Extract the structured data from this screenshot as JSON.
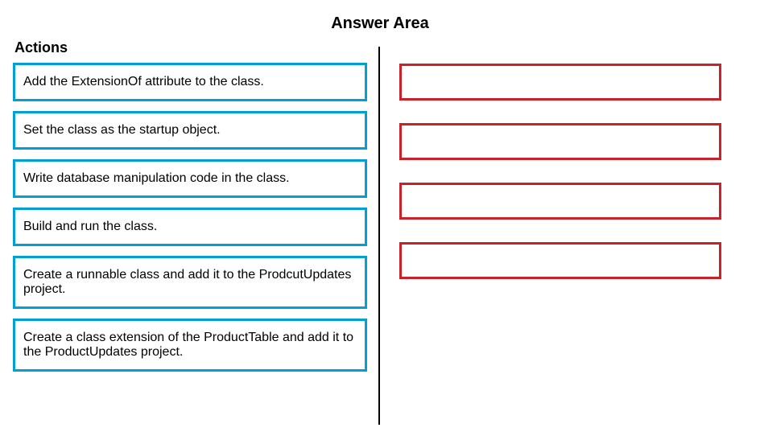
{
  "header": {
    "title": "Answer Area"
  },
  "actions": {
    "heading": "Actions",
    "items": [
      {
        "label": "Add the ExtensionOf attribute to the class.",
        "tall": false
      },
      {
        "label": "Set the class as the startup object.",
        "tall": false
      },
      {
        "label": "Write database manipulation code in the class.",
        "tall": false
      },
      {
        "label": "Build and run the class.",
        "tall": false
      },
      {
        "label": "Create a runnable class and add it to the ProdcutUpdates project.",
        "tall": true
      },
      {
        "label": "Create a class extension of the ProductTable and add it to the ProductUpdates project.",
        "tall": true
      }
    ]
  },
  "answer": {
    "slots": [
      {
        "value": ""
      },
      {
        "value": ""
      },
      {
        "value": ""
      },
      {
        "value": ""
      }
    ]
  }
}
